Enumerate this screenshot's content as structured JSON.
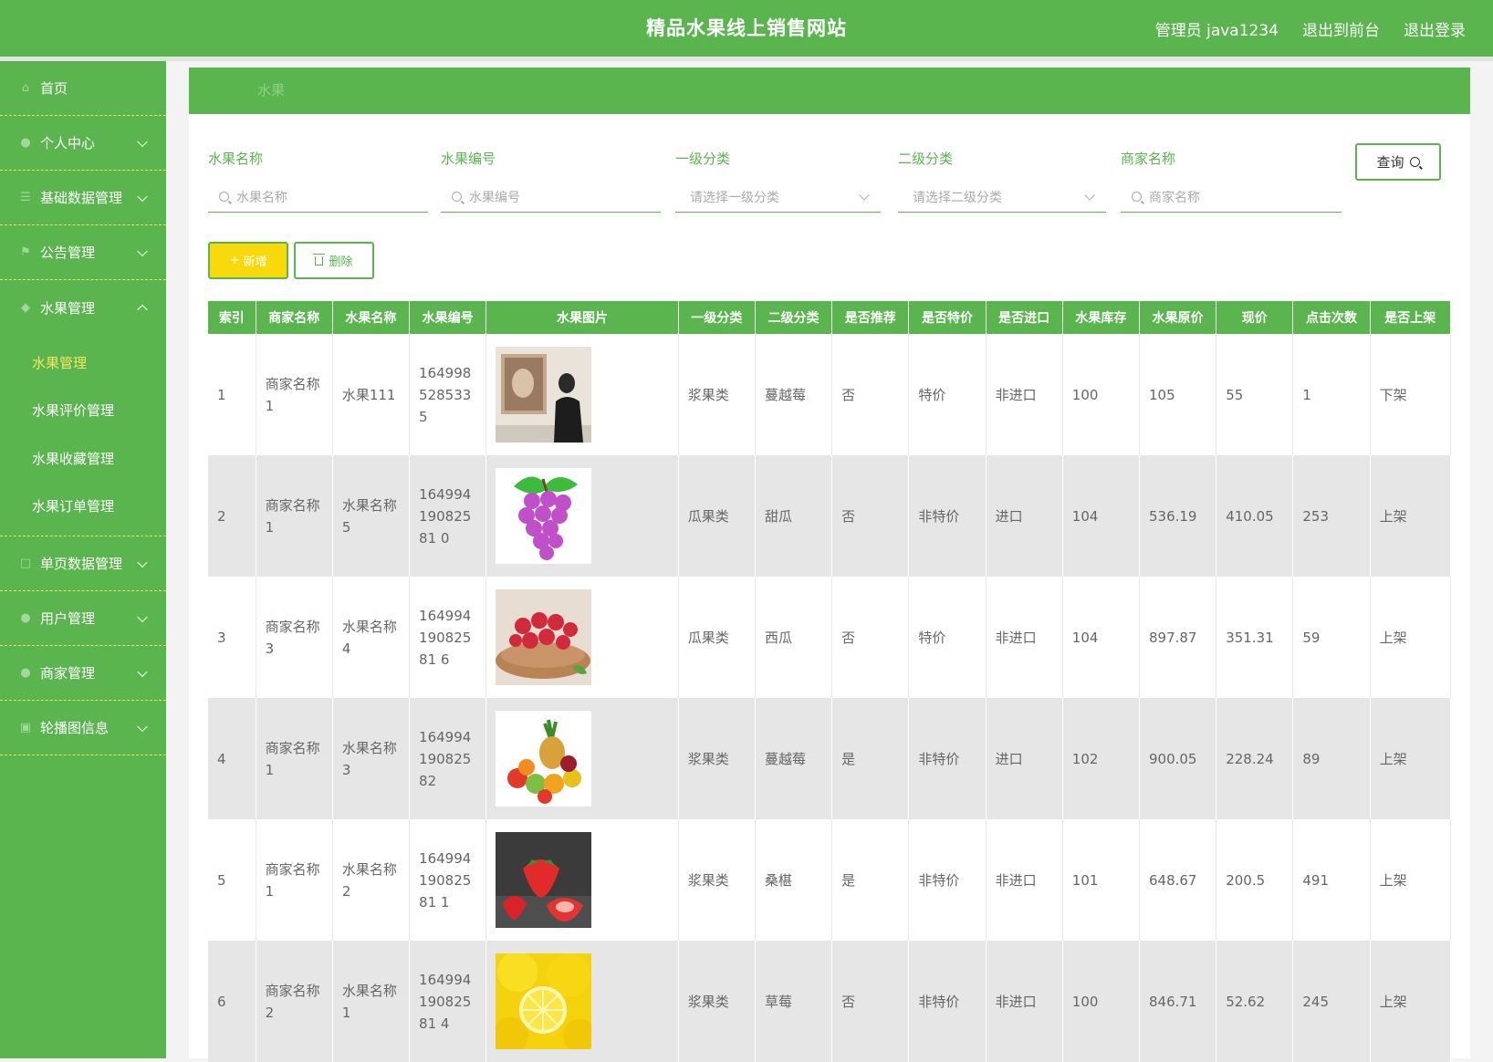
{
  "header": {
    "title": "精品水果线上销售网站",
    "admin": "管理员 java1234",
    "to_front": "退出到前台",
    "logout": "退出登录"
  },
  "sidebar": {
    "items": [
      {
        "label": "首页",
        "icon": "home-icon"
      },
      {
        "label": "个人中心",
        "icon": "user-icon"
      },
      {
        "label": "基础数据管理",
        "icon": "data-icon"
      },
      {
        "label": "公告管理",
        "icon": "notice-icon"
      },
      {
        "label": "水果管理",
        "icon": "fruit-icon"
      },
      {
        "label": "单页数据管理",
        "icon": "page-icon"
      },
      {
        "label": "用户管理",
        "icon": "users-icon"
      },
      {
        "label": "商家管理",
        "icon": "shop-icon"
      },
      {
        "label": "轮播图信息",
        "icon": "carousel-icon"
      }
    ],
    "submenu": [
      {
        "label": "水果管理"
      },
      {
        "label": "水果评价管理"
      },
      {
        "label": "水果收藏管理"
      },
      {
        "label": "水果订单管理"
      }
    ]
  },
  "breadcrumb": "水果",
  "search": {
    "name_label": "水果名称",
    "name_placeholder": "水果名称",
    "code_label": "水果编号",
    "code_placeholder": "水果编号",
    "cat1_label": "一级分类",
    "cat1_placeholder": "请选择一级分类",
    "cat2_label": "二级分类",
    "cat2_placeholder": "请选择二级分类",
    "shop_label": "商家名称",
    "shop_placeholder": "商家名称",
    "query": "查询"
  },
  "actions": {
    "add": "新增",
    "delete": "删除"
  },
  "colors": {
    "primary": "#5ab54f",
    "accent": "#f5e663",
    "add_btn": "#f7d90c"
  },
  "table": {
    "headers": [
      "索引",
      "商家名称",
      "水果名称",
      "水果编号",
      "水果图片",
      "一级分类",
      "二级分类",
      "是否推荐",
      "是否特价",
      "是否进口",
      "水果库存",
      "水果原价",
      "现价",
      "点击次数",
      "是否上架"
    ],
    "rows": [
      {
        "index": "1",
        "shop": "商家名称1",
        "name": "水果111",
        "code": "1649985285335",
        "image": "person-photo",
        "cat1": "浆果类",
        "cat2": "蔓越莓",
        "recommend": "否",
        "special": "特价",
        "imported": "非进口",
        "stock": "100",
        "orig": "105",
        "price": "55",
        "clicks": "1",
        "onsale": "下架"
      },
      {
        "index": "2",
        "shop": "商家名称1",
        "name": "水果名称5",
        "code": "16499419082581 0",
        "image": "grapes",
        "cat1": "瓜果类",
        "cat2": "甜瓜",
        "recommend": "否",
        "special": "非特价",
        "imported": "进口",
        "stock": "104",
        "orig": "536.19",
        "price": "410.05",
        "clicks": "253",
        "onsale": "上架"
      },
      {
        "index": "3",
        "shop": "商家名称3",
        "name": "水果名称4",
        "code": "16499419082581 6",
        "image": "raspberries",
        "cat1": "瓜果类",
        "cat2": "西瓜",
        "recommend": "否",
        "special": "特价",
        "imported": "非进口",
        "stock": "104",
        "orig": "897.87",
        "price": "351.31",
        "clicks": "59",
        "onsale": "上架"
      },
      {
        "index": "4",
        "shop": "商家名称1",
        "name": "水果名称3",
        "code": "16499419082582",
        "image": "fruit-pile",
        "cat1": "浆果类",
        "cat2": "蔓越莓",
        "recommend": "是",
        "special": "非特价",
        "imported": "进口",
        "stock": "102",
        "orig": "900.05",
        "price": "228.24",
        "clicks": "89",
        "onsale": "上架"
      },
      {
        "index": "5",
        "shop": "商家名称1",
        "name": "水果名称2",
        "code": "16499419082581 1",
        "image": "strawberries",
        "cat1": "浆果类",
        "cat2": "桑椹",
        "recommend": "是",
        "special": "非特价",
        "imported": "非进口",
        "stock": "101",
        "orig": "648.67",
        "price": "200.5",
        "clicks": "491",
        "onsale": "上架"
      },
      {
        "index": "6",
        "shop": "商家名称2",
        "name": "水果名称1",
        "code": "16499419082581 4",
        "image": "lemons",
        "cat1": "浆果类",
        "cat2": "草莓",
        "recommend": "否",
        "special": "非特价",
        "imported": "非进口",
        "stock": "100",
        "orig": "846.71",
        "price": "52.62",
        "clicks": "245",
        "onsale": "上架"
      }
    ]
  }
}
